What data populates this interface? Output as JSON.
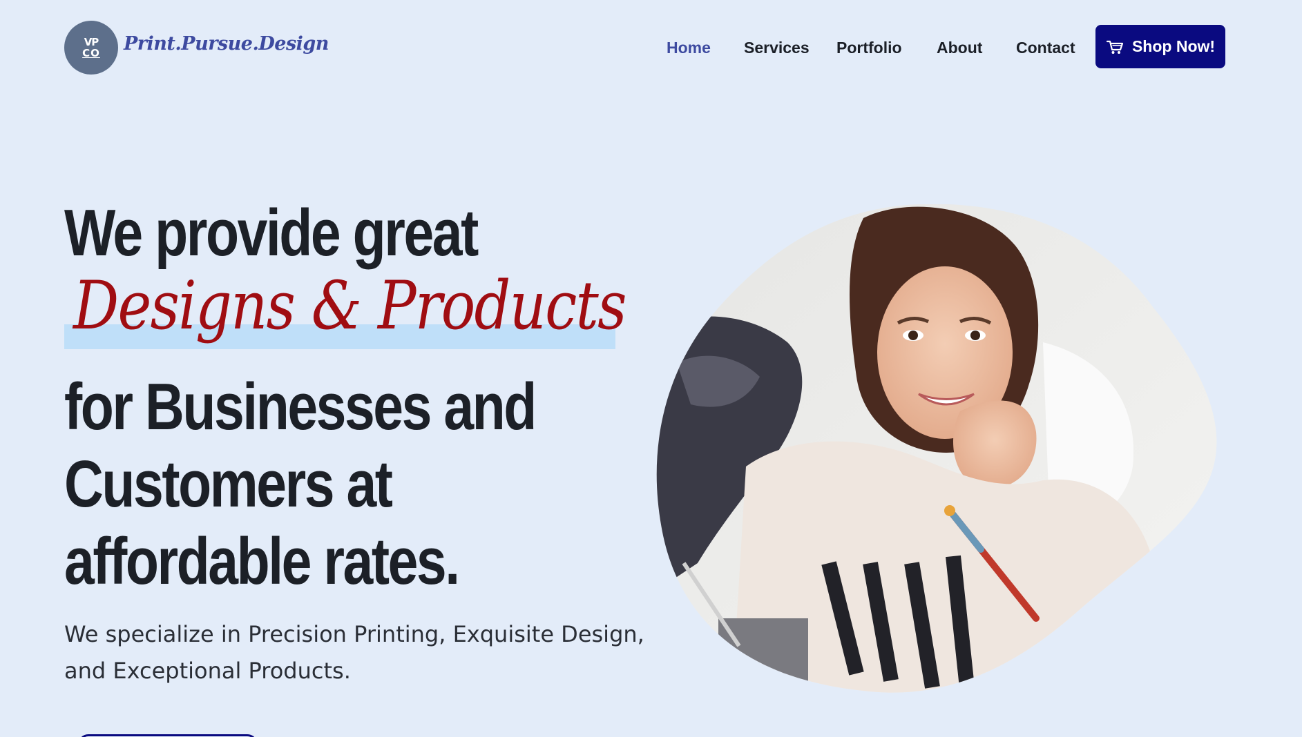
{
  "brand": {
    "badge_line1": "VP",
    "badge_line2": "CO",
    "name": "Print.Pursue.Design"
  },
  "nav": {
    "items": [
      {
        "label": "Home",
        "active": true
      },
      {
        "label": "Services",
        "active": false
      },
      {
        "label": "Portfolio",
        "active": false
      },
      {
        "label": "About",
        "active": false
      },
      {
        "label": "Contact",
        "active": false
      }
    ],
    "cta_label": "Shop Now!",
    "cta_icon": "cart-icon"
  },
  "hero": {
    "line1": "We provide great",
    "script_line": "Designs & Products",
    "line3": "for Businesses and",
    "line4": "Customers at",
    "line5": "affordable rates.",
    "subtext": "We specialize in Precision Printing, Exquisite Design, and Exceptional Products.",
    "image_icon": "woman-portrait-photo"
  },
  "colors": {
    "background": "#e3ecf9",
    "brand_blue": "#3d4aa0",
    "button_navy": "#0a0a80",
    "script_red": "#a00d12",
    "highlight": "#bfdff9",
    "heading": "#1c2027"
  }
}
